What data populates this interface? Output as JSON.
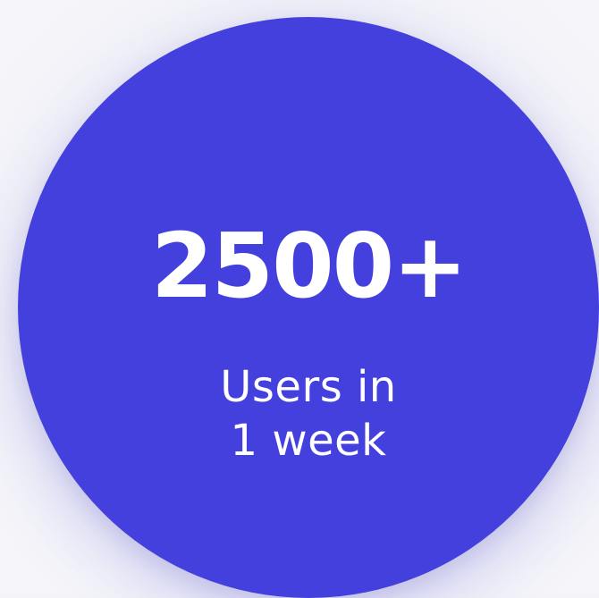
{
  "stat": {
    "value": "2500+",
    "caption_line1": "Users in",
    "caption_line2": "1 week"
  },
  "colors": {
    "circle": "#4440dd",
    "text": "#ffffff",
    "background": "#f3f3f8"
  }
}
